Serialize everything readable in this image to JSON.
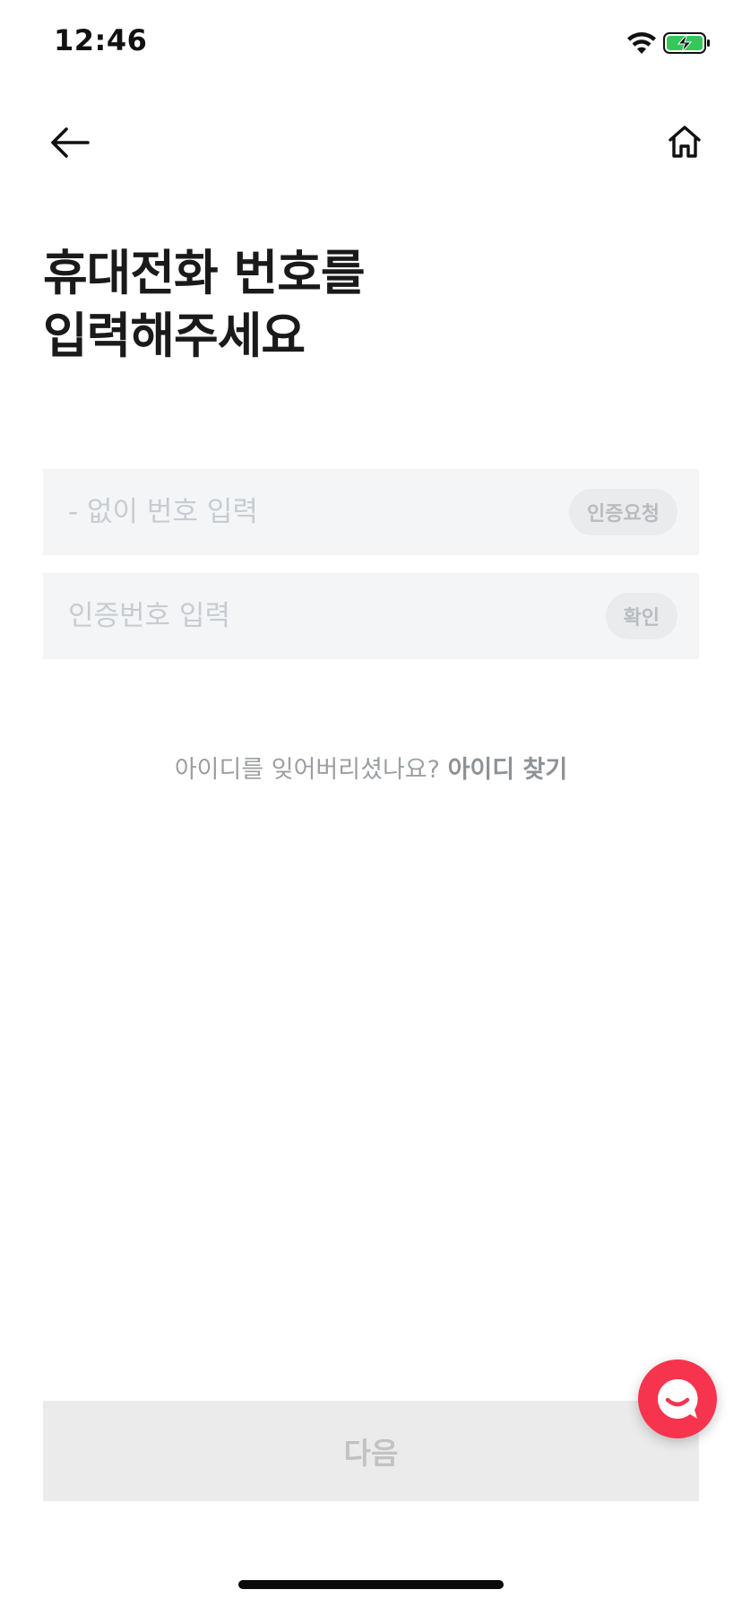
{
  "status_bar": {
    "time": "12:46",
    "wifi_icon": "wifi-icon",
    "battery_icon": "battery-charging-icon",
    "battery_color": "#35c759"
  },
  "nav": {
    "back_icon": "arrow-left-icon",
    "home_icon": "home-icon"
  },
  "title": {
    "line1": "휴대전화 번호를",
    "line2": "입력해주세요"
  },
  "phone_field": {
    "placeholder": "- 없이 번호 입력",
    "value": "",
    "button_label": "인증요청"
  },
  "code_field": {
    "placeholder": "인증번호 입력",
    "value": "",
    "button_label": "확인"
  },
  "find_id": {
    "question": "아이디를 잊어버리셨나요?",
    "link_label": "아이디 찾기"
  },
  "next_button": {
    "label": "다음"
  },
  "chat_fab": {
    "icon": "chat-bubble-icon",
    "color": "#f7344d"
  }
}
